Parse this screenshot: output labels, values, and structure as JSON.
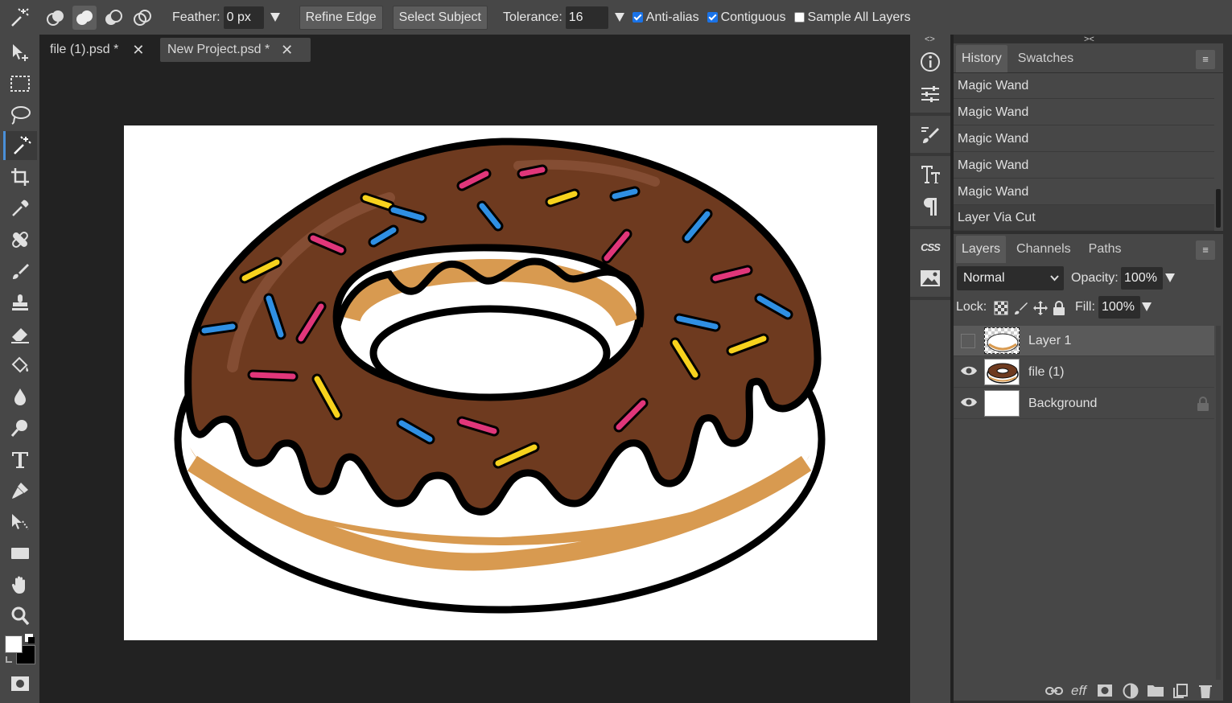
{
  "options_bar": {
    "tool_icon": "magic-wand-icon",
    "feather_label": "Feather:",
    "feather_value": "0 px",
    "refine_edge_label": "Refine Edge",
    "select_subject_label": "Select Subject",
    "tolerance_label": "Tolerance:",
    "tolerance_value": "16",
    "anti_alias_label": "Anti-alias",
    "anti_alias_checked": true,
    "contiguous_label": "Contiguous",
    "contiguous_checked": true,
    "sample_all_layers_label": "Sample All Layers",
    "sample_all_layers_checked": false
  },
  "tabs": [
    {
      "label": "file (1).psd *",
      "active": false
    },
    {
      "label": "New Project.psd *",
      "active": true
    }
  ],
  "toolbar": {
    "tools": [
      "move-icon",
      "marquee-icon",
      "lasso-icon",
      "magic-wand-icon",
      "crop-icon",
      "eyedropper-icon",
      "healing-icon",
      "brush-icon",
      "stamp-icon",
      "eraser-icon",
      "fill-icon",
      "blur-icon",
      "dodge-icon",
      "type-icon",
      "pen-icon",
      "path-select-icon",
      "rectangle-icon",
      "hand-icon",
      "zoom-icon"
    ],
    "active_tool": "magic-wand-icon",
    "foreground_color": "#ffffff",
    "background_color": "#000000"
  },
  "side_icons": [
    "info-icon",
    "adjustments-icon",
    "brush-settings-icon",
    "character-icon",
    "paragraph-icon",
    "css-icon",
    "image-icon"
  ],
  "side_css_label": "CSS",
  "history_panel": {
    "tabs": [
      "History",
      "Swatches"
    ],
    "items": [
      "Magic Wand",
      "Magic Wand",
      "Magic Wand",
      "Magic Wand",
      "Magic Wand",
      "Layer Via Cut"
    ]
  },
  "layers_panel": {
    "tabs": [
      "Layers",
      "Channels",
      "Paths"
    ],
    "blend_mode": "Normal",
    "opacity_label": "Opacity:",
    "opacity_value": "100%",
    "lock_label": "Lock:",
    "fill_label": "Fill:",
    "fill_value": "100%",
    "layers": [
      {
        "name": "Layer 1",
        "visible": false,
        "selected": true
      },
      {
        "name": "file (1)",
        "visible": true,
        "selected": false
      },
      {
        "name": "Background",
        "visible": true,
        "selected": false,
        "locked": true
      }
    ],
    "footer_icons": [
      "link-icon",
      "effects-icon",
      "mask-icon",
      "adjustment-layer-icon",
      "folder-icon",
      "new-layer-icon",
      "trash-icon"
    ],
    "effects_label": "eff"
  },
  "colors": {
    "chocolate": "#6e3a1f",
    "dough": "#d89a50",
    "sprinkle_pink": "#e0367a",
    "sprinkle_blue": "#2f8fe3",
    "sprinkle_yellow": "#f7d21d",
    "accent": "#1a73e8"
  }
}
